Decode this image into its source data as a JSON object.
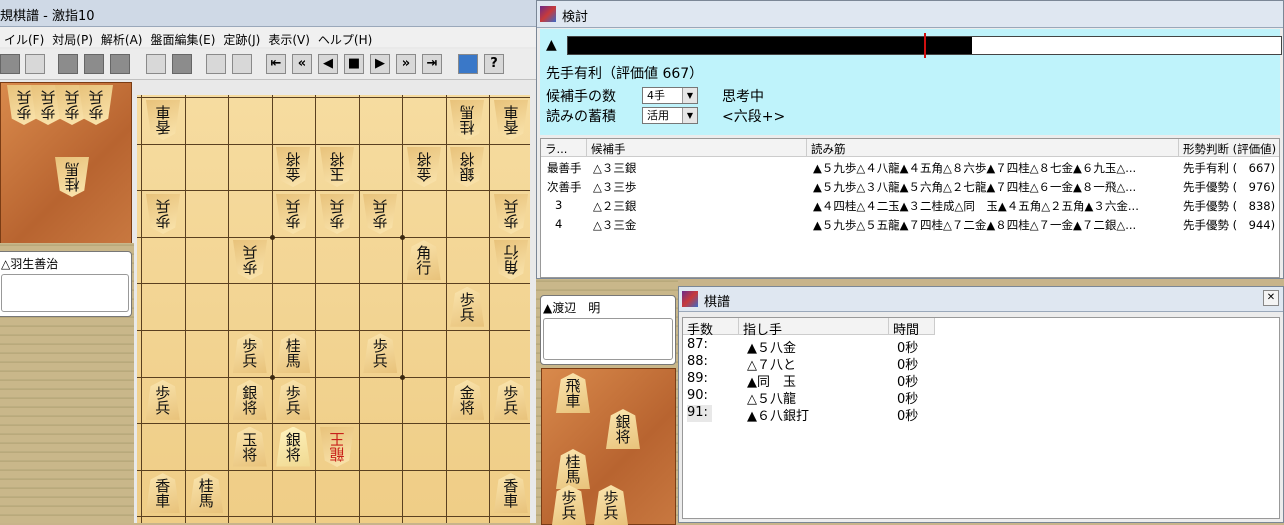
{
  "main": {
    "title": "規棋譜 - 激指10",
    "menu": [
      "イル(F)",
      "対局(P)",
      "解析(A)",
      "盤面編集(E)",
      "定跡(J)",
      "表示(V)",
      "ヘルプ(H)"
    ],
    "gote_player": "△羽生善治",
    "sente_player": "▲渡辺　明"
  },
  "gote_hand": [
    "歩",
    "歩",
    "歩",
    "歩",
    "桂"
  ],
  "sente_hand": [
    "飛",
    "銀",
    "桂",
    "歩",
    "歩"
  ],
  "board_pieces": [
    {
      "file": 9,
      "rank": 1,
      "k": "香",
      "g": true
    },
    {
      "file": 2,
      "rank": 1,
      "k": "桂",
      "g": true
    },
    {
      "file": 1,
      "rank": 1,
      "k": "香",
      "g": true
    },
    {
      "file": 6,
      "rank": 2,
      "k": "金",
      "g": true
    },
    {
      "file": 5,
      "rank": 2,
      "k": "玉",
      "g": true
    },
    {
      "file": 3,
      "rank": 2,
      "k": "金",
      "g": true
    },
    {
      "file": 2,
      "rank": 2,
      "k": "銀",
      "g": true
    },
    {
      "file": 9,
      "rank": 3,
      "k": "歩",
      "g": true
    },
    {
      "file": 6,
      "rank": 3,
      "k": "歩",
      "g": true
    },
    {
      "file": 5,
      "rank": 3,
      "k": "歩",
      "g": true
    },
    {
      "file": 4,
      "rank": 3,
      "k": "歩",
      "g": true
    },
    {
      "file": 1,
      "rank": 3,
      "k": "歩",
      "g": true
    },
    {
      "file": 7,
      "rank": 4,
      "k": "歩",
      "g": true
    },
    {
      "file": 3,
      "rank": 4,
      "k": "角",
      "g": false
    },
    {
      "file": 1,
      "rank": 4,
      "k": "角",
      "g": true
    },
    {
      "file": 2,
      "rank": 5,
      "k": "歩",
      "g": false
    },
    {
      "file": 7,
      "rank": 6,
      "k": "歩",
      "g": false
    },
    {
      "file": 6,
      "rank": 6,
      "k": "桂",
      "g": false
    },
    {
      "file": 4,
      "rank": 6,
      "k": "歩",
      "g": false
    },
    {
      "file": 9,
      "rank": 7,
      "k": "歩",
      "g": false
    },
    {
      "file": 7,
      "rank": 7,
      "k": "銀",
      "g": false
    },
    {
      "file": 6,
      "rank": 7,
      "k": "歩",
      "g": false
    },
    {
      "file": 2,
      "rank": 7,
      "k": "金",
      "g": false
    },
    {
      "file": 1,
      "rank": 7,
      "k": "歩",
      "g": false
    },
    {
      "file": 7,
      "rank": 8,
      "k": "玉",
      "g": false
    },
    {
      "file": 6,
      "rank": 8,
      "k": "銀",
      "g": false,
      "sel": true
    },
    {
      "file": 5,
      "rank": 8,
      "k": "龍",
      "g": true,
      "red": true
    },
    {
      "file": 9,
      "rank": 9,
      "k": "香",
      "g": false
    },
    {
      "file": 8,
      "rank": 9,
      "k": "桂",
      "g": false
    },
    {
      "file": 1,
      "rank": 9,
      "k": "香",
      "g": false
    }
  ],
  "analysis": {
    "title": "検討",
    "eval_marker_sym": "▲",
    "eval_fill_fraction": 0.567,
    "eval_marker_fraction": 0.5,
    "status_text": "先手有利（評価値 667）",
    "candidates_label": "候補手の数",
    "candidates_value": "4手",
    "accum_label": "読みの蓄積",
    "accum_value": "活用",
    "thinking": "思考中",
    "level": "<六段+>",
    "headers": [
      "ラ...",
      "候補手",
      "読み筋",
      "形勢判断 (評価値)"
    ],
    "rows": [
      {
        "rank": "最善手",
        "move": "△３三銀",
        "pv": "▲５九歩△４八龍▲４五角△８六歩▲７四桂△８七金▲６九玉△...",
        "judge": "先手有利 (　667)"
      },
      {
        "rank": "次善手",
        "move": "△３三歩",
        "pv": "▲５九歩△３八龍▲５六角△２七龍▲７四桂△６一金▲８一飛△...",
        "judge": "先手優勢 (　976)"
      },
      {
        "rank": "3",
        "move": "△２三銀",
        "pv": "▲４四桂△４二玉▲３二桂成△同　玉▲４五角△２五角▲３六金...",
        "judge": "先手優勢 (　838)"
      },
      {
        "rank": "4",
        "move": "△３三金",
        "pv": "▲５九歩△５五龍▲７四桂△７二金▲８四桂△７一金▲７二銀△...",
        "judge": "先手優勢 (　944)"
      }
    ]
  },
  "kifu": {
    "title": "棋譜",
    "headers": [
      "手数",
      "指し手",
      "時間"
    ],
    "rows": [
      {
        "n": "87:",
        "move": "▲５八金",
        "time": "0秒"
      },
      {
        "n": "88:",
        "move": "△７八と",
        "time": "0秒"
      },
      {
        "n": "89:",
        "move": "▲同　玉",
        "time": "0秒"
      },
      {
        "n": "90:",
        "move": "△５八龍",
        "time": "0秒"
      },
      {
        "n": "91:",
        "move": "▲６八銀打",
        "time": "0秒"
      }
    ]
  },
  "colors": {
    "accent_cyan": "#bff3fb",
    "eval_marker": "#d01010",
    "board": "#f2d390",
    "komadai": "#b86430"
  }
}
